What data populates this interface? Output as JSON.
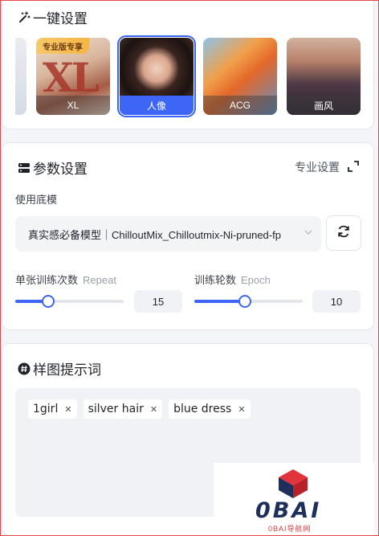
{
  "preset": {
    "title": "一键设置",
    "items": [
      {
        "label": "XL",
        "badge": "专业版专享"
      },
      {
        "label": "人像",
        "selected": true
      },
      {
        "label": "ACG"
      },
      {
        "label": "画风"
      }
    ]
  },
  "params": {
    "title": "参数设置",
    "pro_link": "专业设置",
    "model_label": "使用底模",
    "model_value": "真实感必备模型｜ChilloutMix_Chilloutmix-Ni-pruned-fp",
    "repeat": {
      "label": "单张训练次数",
      "sub": "Repeat",
      "value": "15",
      "level": 0.3
    },
    "epoch": {
      "label": "训练轮数",
      "sub": "Epoch",
      "value": "10",
      "level": 0.47
    }
  },
  "prompt": {
    "title": "样图提示词",
    "tags": [
      "1girl",
      "silver hair",
      "blue dress"
    ]
  },
  "watermark": {
    "text": "0BAI",
    "sub": "0BAI导航网"
  },
  "colors": {
    "accent": "#3d66f6",
    "badge": "#f5b545"
  }
}
